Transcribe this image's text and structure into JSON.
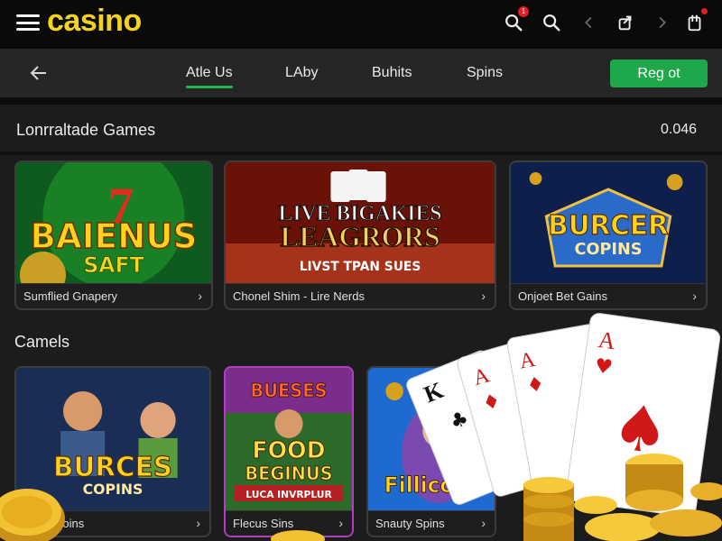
{
  "header": {
    "logo": "casino",
    "notification_count": "1"
  },
  "navbar": {
    "tabs": [
      {
        "label": "Atle Us",
        "active": true
      },
      {
        "label": "LAby",
        "active": false
      },
      {
        "label": "Buhits",
        "active": false
      },
      {
        "label": "Spins",
        "active": false
      }
    ],
    "register_label": "Reg ot"
  },
  "section1": {
    "title": "Lonrraltade Games",
    "value": "0.046",
    "cards": [
      {
        "label": "Sumflied Gnapery",
        "art_title": "BAIENUS",
        "art_sub": "SAFT"
      },
      {
        "label": "Chonel Shim - Lire Nerds",
        "art_title": "LIVE BIGAKIES",
        "art_title2": "LEAGRORS",
        "art_sub": "LIVST TPAN SUES"
      },
      {
        "label": "Onjoet Bet Gains",
        "art_title": "BURCER",
        "art_sub": "COPINS"
      }
    ]
  },
  "section2": {
    "title": "Camels",
    "cards": [
      {
        "label": "Ca   rs Soins",
        "art_title": "BURCES",
        "art_sub": "COPINS"
      },
      {
        "label": "Flecus Sins",
        "art_title": "FOOD",
        "art_title2": "BEGINUS",
        "art_top": "BUESES",
        "art_sub": "LUCA INVRPLUR"
      },
      {
        "label": "Snauty Spins",
        "art_title": "Fillicota"
      }
    ]
  },
  "colors": {
    "accent": "#1ea84a",
    "logo": "#f5d31c",
    "badge": "#e02020"
  }
}
